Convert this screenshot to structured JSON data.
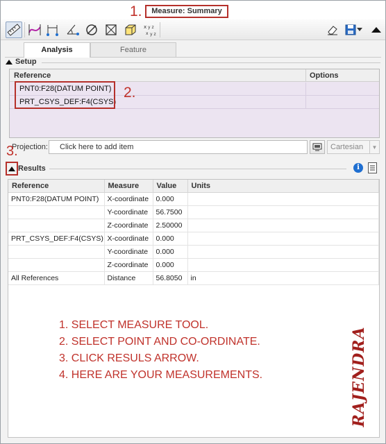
{
  "window": {
    "title": "Measure: Summary"
  },
  "annotations": {
    "one": "1.",
    "two": "2.",
    "three": "3."
  },
  "toolbar": {
    "tools": [
      {
        "icon": "ruler-measure-icon",
        "active": true
      },
      {
        "icon": "curve-length-icon"
      },
      {
        "icon": "distance-icon"
      },
      {
        "icon": "angle-icon"
      },
      {
        "icon": "diameter-icon"
      },
      {
        "icon": "area-icon"
      },
      {
        "icon": "volume-icon"
      },
      {
        "icon": "transform-xyz-icon"
      }
    ],
    "right": [
      "eraser-icon",
      "save-icon",
      "dropdown-icon",
      "collapse-icon"
    ]
  },
  "tabs": [
    {
      "label": "Analysis",
      "active": true
    },
    {
      "label": "Feature",
      "active": false
    }
  ],
  "setup": {
    "title": "Setup",
    "columns": [
      "Reference",
      "Options"
    ],
    "rows": [
      "PNT0:F28(DATUM POINT)",
      "PRT_CSYS_DEF:F4(CSYS)"
    ]
  },
  "projection": {
    "label": "Projection:",
    "placeholder": "Click here to add item",
    "coordinate_system": "Cartesian"
  },
  "results": {
    "title": "Results",
    "columns": [
      "Reference",
      "Measure",
      "Value",
      "Units"
    ],
    "rows": [
      [
        "PNT0:F28(DATUM POINT)",
        "X-coordinate",
        "0.000",
        ""
      ],
      [
        "",
        "Y-coordinate",
        "56.7500",
        ""
      ],
      [
        "",
        "Z-coordinate",
        "2.50000",
        ""
      ],
      [
        "PRT_CSYS_DEF:F4(CSYS)",
        "X-coordinate",
        "0.000",
        ""
      ],
      [
        "",
        "Y-coordinate",
        "0.000",
        ""
      ],
      [
        "",
        "Z-coordinate",
        "0.000",
        ""
      ],
      [
        "All References",
        "Distance",
        "56.8050",
        "in"
      ]
    ]
  },
  "instructions": [
    "1. SELECT MEASURE TOOL.",
    "2. SELECT POINT AND CO-ORDINATE.",
    "3. CLICK RESULS ARROW.",
    "4. HERE ARE YOUR MEASUREMENTS."
  ],
  "signature": "RAJENDRA",
  "colors": {
    "annotation": "#c0322b",
    "setup_rows": "#ece4f1",
    "info_blue": "#1f6fd1"
  }
}
